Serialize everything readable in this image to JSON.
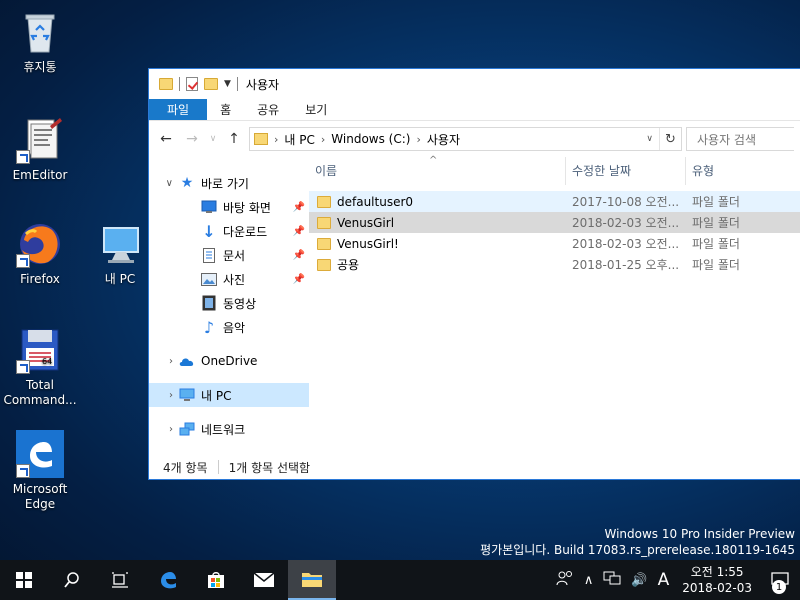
{
  "desktop": {
    "icons": [
      {
        "label": "휴지통",
        "icon": "recycle-bin-icon"
      },
      {
        "label": "EmEditor",
        "icon": "emeditor-icon"
      },
      {
        "label": "Firefox",
        "icon": "firefox-icon"
      },
      {
        "label": "내 PC",
        "icon": "this-pc-icon"
      },
      {
        "label": "Total Command...",
        "icon": "total-commander-icon"
      },
      {
        "label": "Microsoft Edge",
        "icon": "edge-icon"
      }
    ]
  },
  "window": {
    "title": "사용자",
    "ribbon_tabs": [
      "파일",
      "홈",
      "공유",
      "보기"
    ],
    "address": {
      "crumbs": [
        "내 PC",
        "Windows (C:)",
        "사용자"
      ]
    },
    "search_placeholder": "사용자 검색",
    "nav": {
      "quick_access": "바로 가기",
      "quick_items": [
        "바탕 화면",
        "다운로드",
        "문서",
        "사진",
        "동영상",
        "음악"
      ],
      "onedrive": "OneDrive",
      "this_pc": "내 PC",
      "network": "네트워크"
    },
    "columns": {
      "name": "이름",
      "date": "수정한 날짜",
      "type": "유형"
    },
    "files": [
      {
        "name": "defaultuser0",
        "date": "2017-10-08 오전...",
        "type": "파일 폴더"
      },
      {
        "name": "VenusGirl",
        "date": "2018-02-03 오전...",
        "type": "파일 폴더"
      },
      {
        "name": "VenusGirl!",
        "date": "2018-02-03 오전...",
        "type": "파일 폴더"
      },
      {
        "name": "공용",
        "date": "2018-01-25 오후...",
        "type": "파일 폴더"
      }
    ],
    "status": {
      "count": "4개 항목",
      "selected": "1개 항목 선택함"
    }
  },
  "watermark": {
    "line1": "Windows 10 Pro Insider Preview",
    "line2": "평가본입니다. Build 17083.rs_prerelease.180119-1645"
  },
  "taskbar": {
    "ime": "A",
    "time": "오전 1:55",
    "date": "2018-02-03",
    "notification_count": "1"
  },
  "colors": {
    "accent": "#1979ca",
    "selection": "#cce8ff",
    "folder": "#f8d775"
  }
}
